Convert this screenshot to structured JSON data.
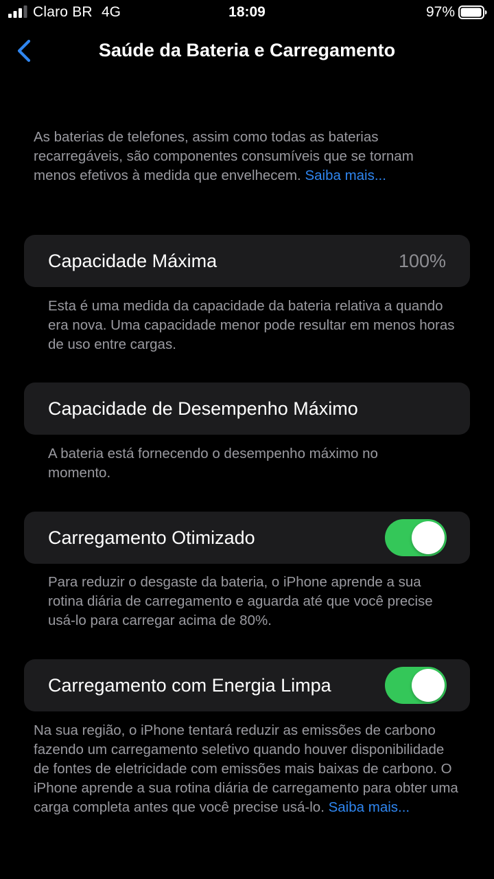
{
  "status_bar": {
    "carrier": "Claro BR",
    "network": "4G",
    "time": "18:09",
    "battery_percent": "97%",
    "signal_bars_active": 3,
    "signal_bars_total": 4,
    "battery_level": 0.97
  },
  "nav": {
    "back_icon": "chevron-left-icon",
    "title": "Saúde da Bateria e Carregamento"
  },
  "intro": {
    "text": "As baterias de telefones, assim como todas as baterias recarregáveis, são componentes consumíveis que se tornam menos efetivos à medida que envelhecem. ",
    "link": "Saiba mais..."
  },
  "max_capacity": {
    "label": "Capacidade Máxima",
    "value": "100%",
    "footnote": "Esta é uma medida da capacidade da bateria relativa a quando era nova. Uma capacidade menor pode resultar em menos horas de uso entre cargas."
  },
  "peak_performance": {
    "label": "Capacidade de Desempenho Máximo",
    "footnote": "A bateria está fornecendo o desempenho máximo no momento."
  },
  "optimized_charging": {
    "label": "Carregamento Otimizado",
    "enabled": true,
    "footnote": "Para reduzir o desgaste da bateria, o iPhone aprende a sua rotina diária de carregamento e aguarda até que você precise usá-lo para carregar acima de 80%."
  },
  "clean_energy": {
    "label": "Carregamento com Energia Limpa",
    "enabled": true,
    "footnote": "Na sua região, o iPhone tentará reduzir as emissões de carbono fazendo um carregamento seletivo quando houver disponibilidade de fontes de eletricidade com emissões mais baixas de carbono. O iPhone aprende a sua rotina diária de carregamento para obter uma carga completa antes que você precise usá-lo. ",
    "link": "Saiba mais..."
  },
  "colors": {
    "background": "#000000",
    "card": "#1c1c1e",
    "accent_blue": "#2f86f0",
    "toggle_on": "#34c759",
    "secondary_text": "#9a9aa0"
  }
}
